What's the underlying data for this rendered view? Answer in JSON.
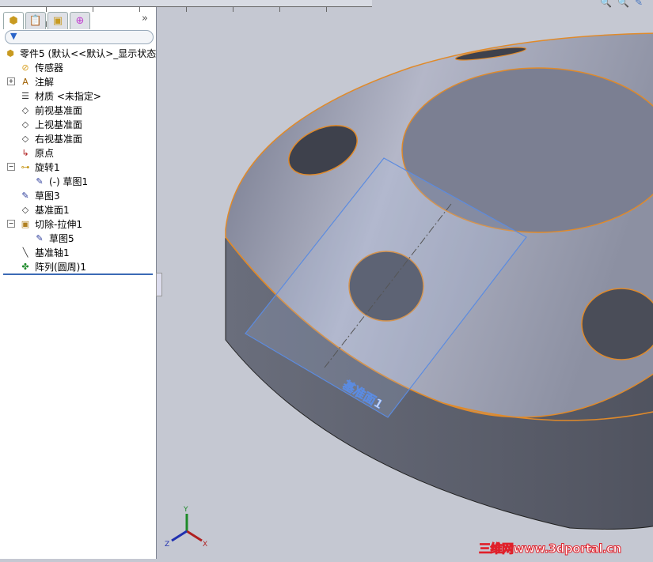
{
  "panel_tabs": [
    {
      "icon": "feature-manager-icon"
    },
    {
      "icon": "property-manager-icon"
    },
    {
      "icon": "configuration-manager-icon"
    },
    {
      "icon": "dimxpert-icon"
    }
  ],
  "more_label": "»",
  "tree": {
    "root": "零件5  (默认<<默认>_显示状态",
    "items": [
      {
        "label": "传感器",
        "icon": "sensor-folder-icon"
      },
      {
        "label": "注解",
        "icon": "annotation-folder-icon",
        "expander": "+"
      },
      {
        "label": "材质 <未指定>",
        "icon": "material-icon"
      },
      {
        "label": "前视基准面",
        "icon": "plane-icon"
      },
      {
        "label": "上视基准面",
        "icon": "plane-icon"
      },
      {
        "label": "右视基准面",
        "icon": "plane-icon"
      },
      {
        "label": "原点",
        "icon": "origin-icon"
      },
      {
        "label": "旋转1",
        "icon": "revolve-icon",
        "expander": "−"
      },
      {
        "label": "(-) 草图1",
        "icon": "sketch-icon",
        "child": true
      },
      {
        "label": "草图3",
        "icon": "sketch-icon"
      },
      {
        "label": "基准面1",
        "icon": "plane-icon"
      },
      {
        "label": "切除-拉伸1",
        "icon": "cut-extrude-icon",
        "expander": "−"
      },
      {
        "label": "草图5",
        "icon": "sketch-icon",
        "child": true
      },
      {
        "label": "基准轴1",
        "icon": "axis-icon"
      },
      {
        "label": "阵列(圆周)1",
        "icon": "circular-pattern-icon"
      }
    ]
  },
  "viewport": {
    "plane_label": "基准面1",
    "triad": {
      "x": "X",
      "y": "Y",
      "z": "Z"
    },
    "colors": {
      "background": "#c5c8d2",
      "edge": "#e08a2a",
      "plane": "#5b8be0"
    }
  },
  "watermark": "三维网www.3dportal.cn"
}
